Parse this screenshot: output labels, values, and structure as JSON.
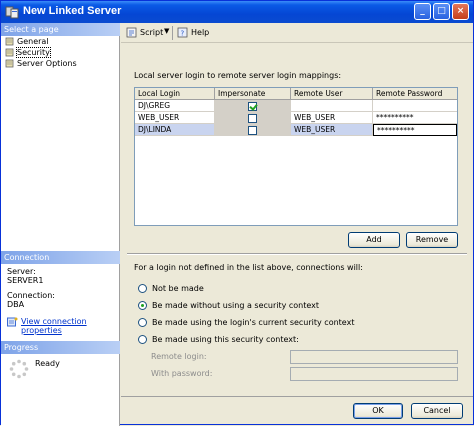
{
  "window": {
    "title": "New Linked Server"
  },
  "left_pane": {
    "select_page_header": "Select a page",
    "pages": [
      {
        "label": "General"
      },
      {
        "label": "Security"
      },
      {
        "label": "Server Options"
      }
    ],
    "connection_header": "Connection",
    "server_label": "Server:",
    "server_value": "SERVER1",
    "connection_label": "Connection:",
    "connection_value": "DBA",
    "view_connection_link": "View connection properties",
    "progress_header": "Progress",
    "progress_status": "Ready"
  },
  "toolbar": {
    "script_label": "Script",
    "help_label": "Help"
  },
  "security": {
    "mapping_label": "Local server login to remote server login mappings:",
    "columns": [
      "Local Login",
      "Impersonate",
      "Remote User",
      "Remote Password"
    ],
    "rows": [
      {
        "local_login": "DJ\\GREG",
        "impersonate": true,
        "remote_user": "",
        "remote_password": ""
      },
      {
        "local_login": "WEB_USER",
        "impersonate": false,
        "remote_user": "WEB_USER",
        "remote_password": "**********"
      },
      {
        "local_login": "DJ\\LINDA",
        "impersonate": false,
        "remote_user": "WEB_USER",
        "remote_password": "**********"
      }
    ],
    "add_button": "Add",
    "remove_button": "Remove",
    "not_defined_label": "For a login not defined in the list above, connections will:",
    "options": [
      {
        "label": "Not be made",
        "selected": false
      },
      {
        "label": "Be made without using a security context",
        "selected": true
      },
      {
        "label": "Be made using the login's current security context",
        "selected": false
      },
      {
        "label": "Be made using this security context:",
        "selected": false
      }
    ],
    "remote_login_label": "Remote login:",
    "with_password_label": "With password:"
  },
  "footer": {
    "ok_label": "OK",
    "cancel_label": "Cancel"
  }
}
